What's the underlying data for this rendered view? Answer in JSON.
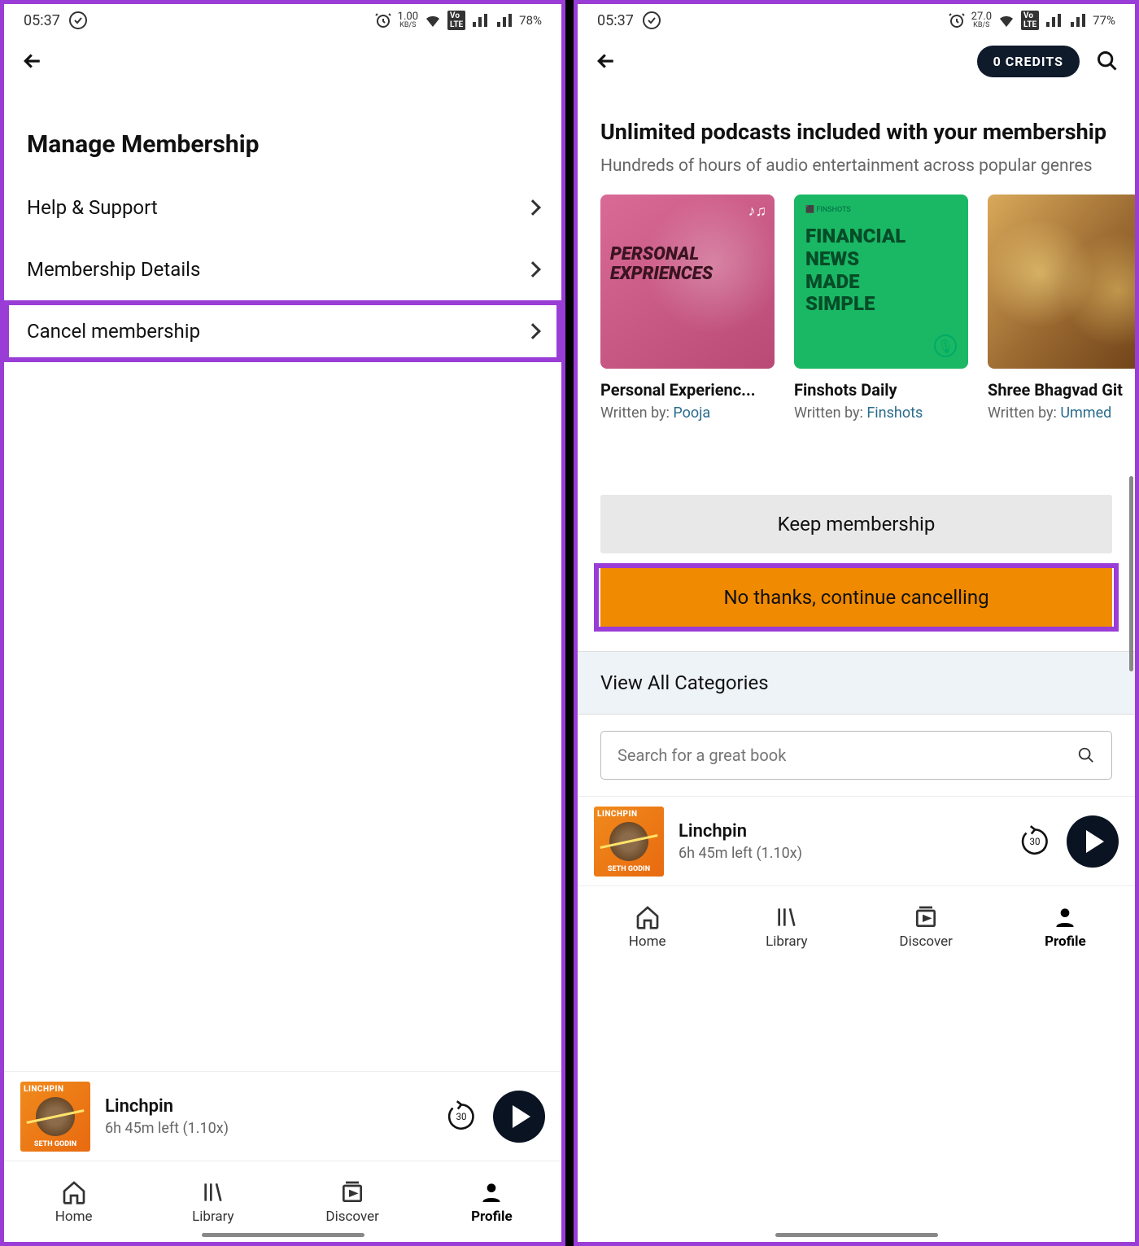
{
  "left": {
    "status": {
      "time": "05:37",
      "kbs": "1.00",
      "kbs_unit": "KB/S",
      "lte": "VoLTE1",
      "battery": "78%"
    },
    "page_title": "Manage Membership",
    "rows": {
      "help": "Help & Support",
      "details": "Membership Details",
      "cancel": "Cancel membership"
    }
  },
  "right": {
    "status": {
      "time": "05:37",
      "kbs": "27.0",
      "kbs_unit": "KB/S",
      "lte": "VoLTE2",
      "battery": "77%"
    },
    "credits": "0 CREDITS",
    "section_title": "Unlimited podcasts included with your membership",
    "section_sub": "Hundreds of hours of audio entertainment across popular genres",
    "podcasts": [
      {
        "cover_text": "PERSONAL\nEXPRIENCES",
        "title": "Personal Experienc...",
        "author_prefix": "Written by: ",
        "author": "Pooja"
      },
      {
        "cover_text": "FINANCIAL\nNEWS\nMADE\nSIMPLE",
        "title": "Finshots Daily",
        "author_prefix": "Written by: ",
        "author": "Finshots"
      },
      {
        "cover_text": "",
        "title": "Shree Bhagvad Git",
        "author_prefix": "Written by: ",
        "author": "Ummed"
      }
    ],
    "keep_button": "Keep membership",
    "cancel_button": "No thanks, continue cancelling",
    "view_all": "View All Categories",
    "search_placeholder": "Search for a great book"
  },
  "player": {
    "cover_top": "LINCHPIN",
    "cover_bottom": "SETH GODIN",
    "title": "Linchpin",
    "subtitle": "6h 45m left (1.10x)",
    "skip": "30"
  },
  "bottom_nav": {
    "home": "Home",
    "library": "Library",
    "discover": "Discover",
    "profile": "Profile"
  }
}
